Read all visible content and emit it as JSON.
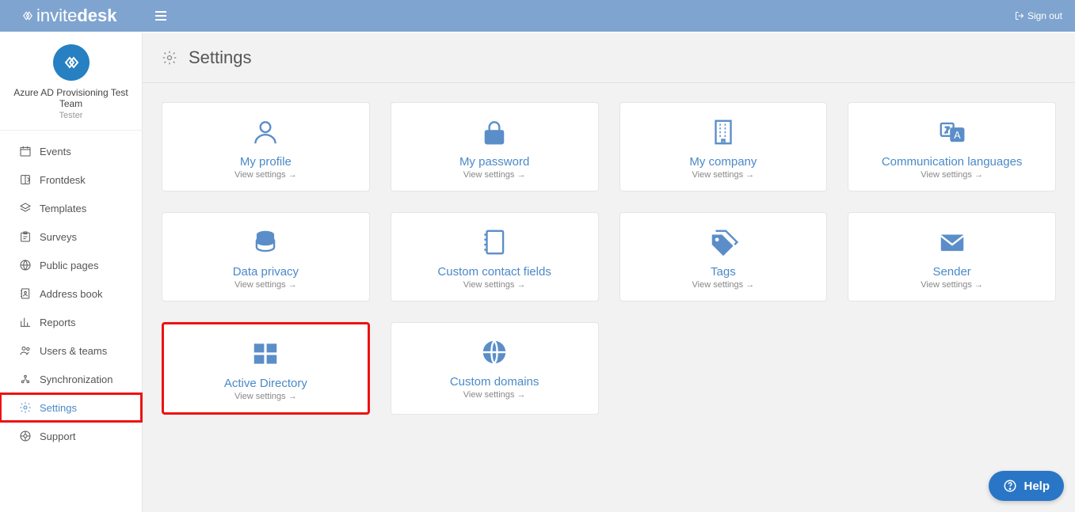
{
  "brand": {
    "name_light": "invite",
    "name_bold": "desk"
  },
  "topbar": {
    "signout": "Sign out"
  },
  "org": {
    "name": "Azure AD Provisioning Test Team",
    "role": "Tester"
  },
  "sidebar": {
    "items": [
      {
        "label": "Events"
      },
      {
        "label": "Frontdesk"
      },
      {
        "label": "Templates"
      },
      {
        "label": "Surveys"
      },
      {
        "label": "Public pages"
      },
      {
        "label": "Address book"
      },
      {
        "label": "Reports"
      },
      {
        "label": "Users & teams"
      },
      {
        "label": "Synchronization"
      },
      {
        "label": "Settings"
      },
      {
        "label": "Support"
      }
    ]
  },
  "page": {
    "title": "Settings"
  },
  "cards": [
    {
      "title": "My profile",
      "sub": "View settings →"
    },
    {
      "title": "My password",
      "sub": "View settings →"
    },
    {
      "title": "My company",
      "sub": "View settings →"
    },
    {
      "title": "Communication languages",
      "sub": "View settings →"
    },
    {
      "title": "Data privacy",
      "sub": "View settings →"
    },
    {
      "title": "Custom contact fields",
      "sub": "View settings →"
    },
    {
      "title": "Tags",
      "sub": "View settings →"
    },
    {
      "title": "Sender",
      "sub": "View settings →"
    },
    {
      "title": "Active Directory",
      "sub": "View settings →"
    },
    {
      "title": "Custom domains",
      "sub": "View settings →"
    }
  ],
  "help": {
    "label": "Help"
  }
}
